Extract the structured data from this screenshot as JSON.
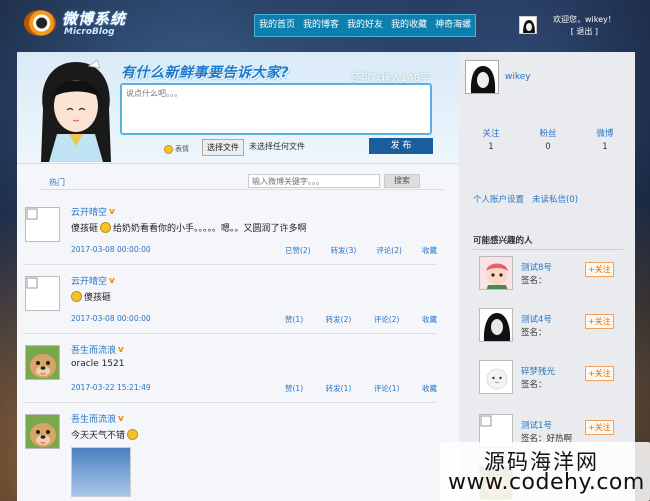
{
  "logo": {
    "cn": "微博系统",
    "en": "MicroBlog"
  },
  "nav": [
    "我的首页",
    "我的博客",
    "我的好友",
    "我的收藏",
    "神奇海螺"
  ],
  "header": {
    "welcome": "欢迎您，wikey！",
    "logout": "[ 退出 ]"
  },
  "publish": {
    "slogan": "有什么新鲜事要告诉大家?",
    "remaining": "还可以输入140字",
    "placeholder": "说点什么吧。。。",
    "emoji_label": "表情",
    "file_button": "选择文件",
    "file_status": "未选择任何文件",
    "submit": "发 布"
  },
  "toolbar": {
    "hot_tab": "热门",
    "search_placeholder": "输入微博关键字。。。",
    "search_button": "搜索"
  },
  "posts": [
    {
      "author": "云开晴空",
      "text_before": "傻孩砸",
      "text_after": "给奶奶看看你的小手。。。。。嗯。。又圆润了许多啊",
      "time": "2017-03-08 00:00:00",
      "likes": "已赞(2)",
      "reposts": "转发(3)",
      "comments": "评论(2)",
      "fav": "收藏",
      "has_face_before": true
    },
    {
      "author": "云开晴空",
      "text_before": "",
      "text_after": "傻孩砸",
      "time": "2017-03-08 00:00:00",
      "likes": "赞(1)",
      "reposts": "转发(2)",
      "comments": "评论(2)",
      "fav": "收藏",
      "has_face_before": true
    },
    {
      "author": "吾生而流浪",
      "text_before": "",
      "text_after": "oracle 1521",
      "time": "2017-03-22 15:21:49",
      "likes": "赞(1)",
      "reposts": "转发(1)",
      "comments": "评论(1)",
      "fav": "收藏",
      "has_face_before": false
    },
    {
      "author": "吾生而流浪",
      "text_before": "今天天气不错",
      "text_after": "",
      "time": "",
      "likes": "",
      "reposts": "",
      "comments": "",
      "fav": "",
      "has_face_before": false
    }
  ],
  "profile": {
    "name": "wikey",
    "stats": [
      {
        "label": "关注",
        "value": "1"
      },
      {
        "label": "粉丝",
        "value": "0"
      },
      {
        "label": "微博",
        "value": "1"
      }
    ],
    "links": [
      "个人账户设置",
      "未读私信(0)"
    ]
  },
  "suggestions": {
    "title": "可能感兴趣的人",
    "sign_label": "签名：",
    "follow_label": "+关注",
    "people": [
      {
        "name": "测试8号",
        "sign": ""
      },
      {
        "name": "测试4号",
        "sign": ""
      },
      {
        "name": "碎梦残光",
        "sign": ""
      },
      {
        "name": "测试1号",
        "sign": "好热啊"
      }
    ]
  },
  "watermark": {
    "cn": "源码海洋网",
    "url": "www.codehy.com"
  },
  "colors": {
    "nav_bg": "#0d7fae",
    "link": "#2a74c4",
    "publish_btn": "#1b5e9e",
    "follow": "#e26b00"
  }
}
